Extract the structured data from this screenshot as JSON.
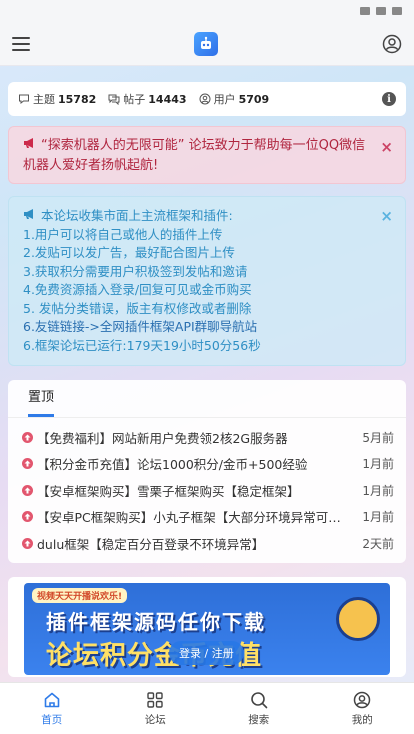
{
  "stats": {
    "topics_label": "主题",
    "topics_value": "15782",
    "posts_label": "帖子",
    "posts_value": "14443",
    "users_label": "用户",
    "users_value": "5709"
  },
  "alert_red": {
    "text": "“探索机器人的无限可能” 论坛致力于帮助每一位QQ微信机器人爱好者扬帆起航!",
    "close": "×"
  },
  "alert_blue": {
    "lines": [
      "本论坛收集市面上主流框架和插件:",
      "1.用户可以将自己或他人的插件上传",
      "2.发贴可以发广告，最好配合图片上传",
      "3.获取积分需要用户积极签到发帖和邀请",
      "4.免费资源插入登录/回复可见或金币购买",
      "5. 发帖分类错误，版主有权修改或者删除",
      "6.友链链接->全网插件框架API群聊导航站",
      "6.框架论坛已运行:179天19小时50分56秒"
    ],
    "close": "×"
  },
  "pinned": {
    "tab_label": "置顶",
    "items": [
      {
        "title": "【免费福利】网站新用户免费领2核2G服务器",
        "time": "5月前"
      },
      {
        "title": "【积分金币充值】论坛1000积分/金币+500经验",
        "time": "1月前"
      },
      {
        "title": "【安卓框架购买】雪栗子框架购买【稳定框架】",
        "time": "1月前"
      },
      {
        "title": "【安卓PC框架购买】小丸子框架【大部分环境异常可…",
        "time": "1月前"
      },
      {
        "title": "dulu框架【稳定百分百登录不环境异常】",
        "time": "2天前"
      }
    ]
  },
  "banner": {
    "tag": "视频天天开播说欢乐!",
    "line1": "插件框架源码任你下载",
    "line2": "论坛积分金币充值"
  },
  "login_pill": "登录 / 注册",
  "bottom_nav": {
    "home": "首页",
    "forum": "论坛",
    "search": "搜索",
    "me": "我的"
  },
  "colors": {
    "accent": "#2f7be8",
    "alert_red_text": "#b0263f",
    "alert_blue_text": "#2f8fc4",
    "pin_icon": "#e2566e"
  }
}
